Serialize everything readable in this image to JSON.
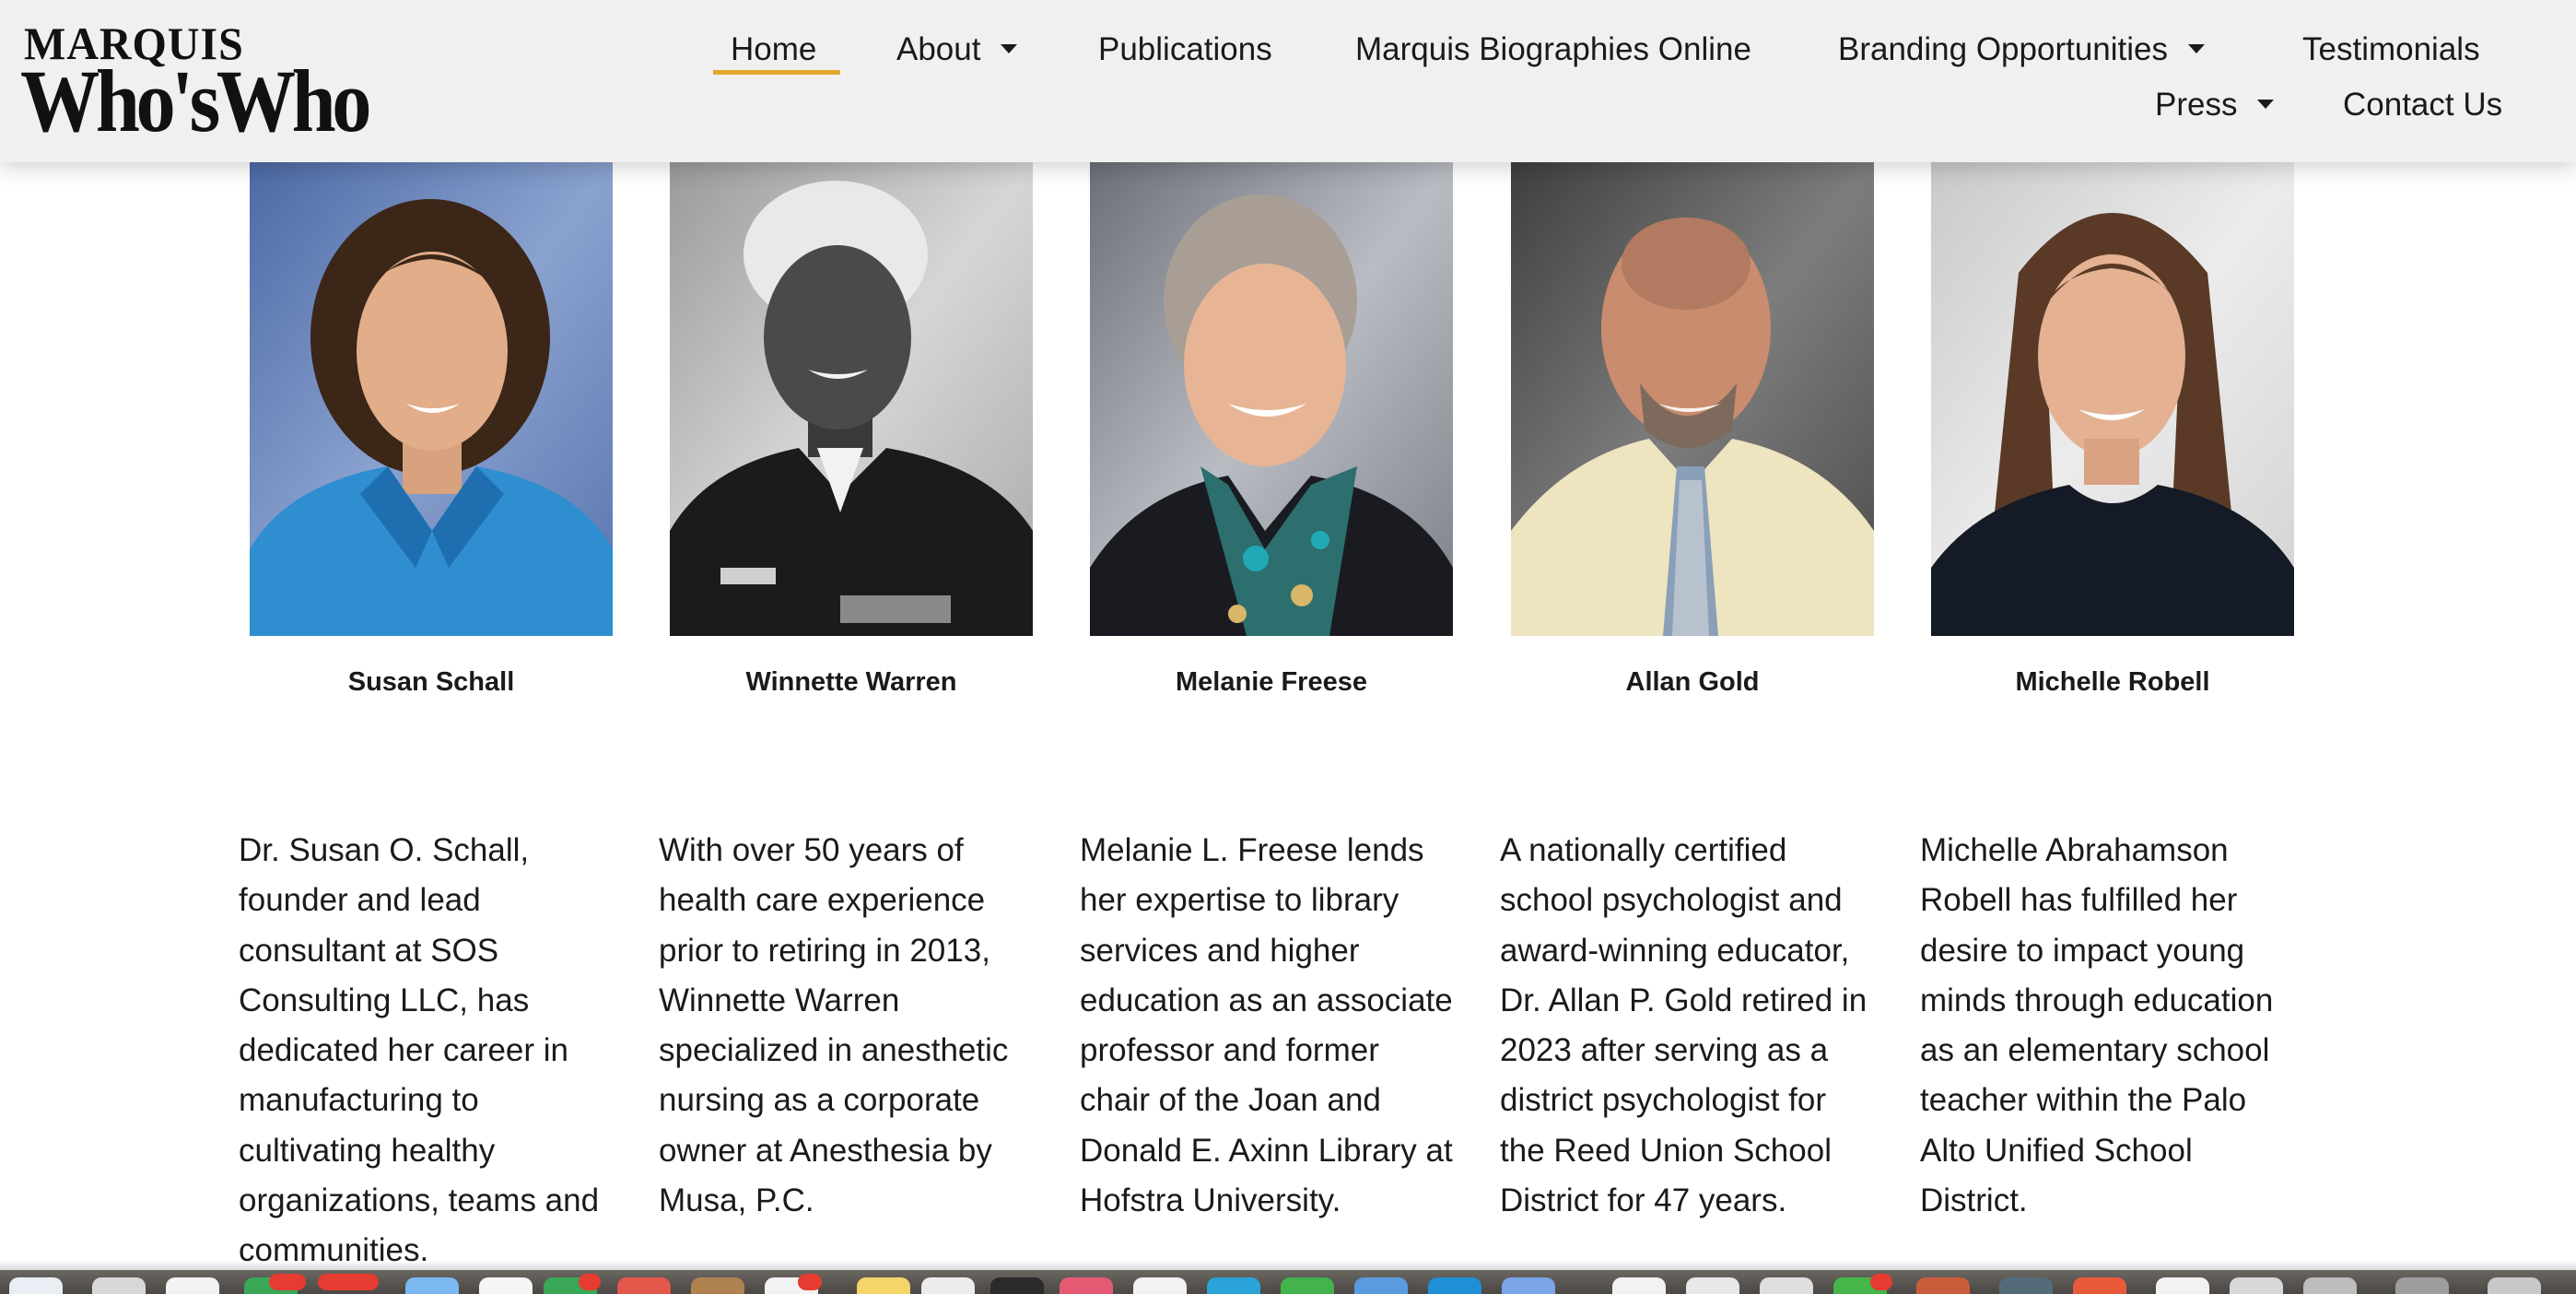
{
  "header": {
    "logo": {
      "line1": "MARQUIS",
      "line2": "Who'sWho"
    },
    "nav": [
      {
        "label": "Home",
        "active": true,
        "has_dropdown": false
      },
      {
        "label": "About",
        "active": false,
        "has_dropdown": true
      },
      {
        "label": "Publications",
        "active": false,
        "has_dropdown": false
      },
      {
        "label": "Marquis Biographies Online",
        "active": false,
        "has_dropdown": false
      },
      {
        "label": "Branding Opportunities",
        "active": false,
        "has_dropdown": true
      },
      {
        "label": "Testimonials",
        "active": false,
        "has_dropdown": false
      },
      {
        "label": "Press",
        "active": false,
        "has_dropdown": true
      },
      {
        "label": "Contact Us",
        "active": false,
        "has_dropdown": false
      }
    ],
    "accent_color": "#e3a82b"
  },
  "members": [
    {
      "name": "Susan Schall",
      "bio_lines": [
        "Dr. Susan O. Schall,",
        "founder and lead",
        "consultant at SOS",
        "Consulting LLC, has",
        "dedicated her career in",
        "manufacturing to",
        "cultivating healthy",
        "organizations, teams and",
        "communities."
      ]
    },
    {
      "name": "Winnette Warren",
      "bio_lines": [
        "With over 50 years of",
        "health care experience",
        "prior to retiring in 2013,",
        "Winnette Warren",
        "specialized in anesthetic",
        "nursing as a corporate",
        "owner at Anesthesia by",
        "Musa, P.C."
      ]
    },
    {
      "name": "Melanie Freese",
      "bio_lines": [
        "Melanie L. Freese lends",
        "her expertise to library",
        "services and higher",
        "education as an associate",
        "professor and former",
        "chair of the Joan and",
        "Donald E. Axinn Library at",
        "Hofstra University."
      ]
    },
    {
      "name": "Allan Gold",
      "bio_lines": [
        "A nationally certified",
        "school psychologist and",
        "award-winning educator,",
        "Dr. Allan P. Gold retired in",
        "2023 after serving as a",
        "district psychologist for",
        "the Reed Union School",
        "District for 47 years."
      ]
    },
    {
      "name": "Michelle Robell",
      "bio_lines": [
        "Michelle Abrahamson",
        "Robell has fulfilled her",
        "desire to impact young",
        "minds through education",
        "as an elementary school",
        "teacher within the Palo",
        "Alto Unified School",
        "District."
      ]
    }
  ]
}
